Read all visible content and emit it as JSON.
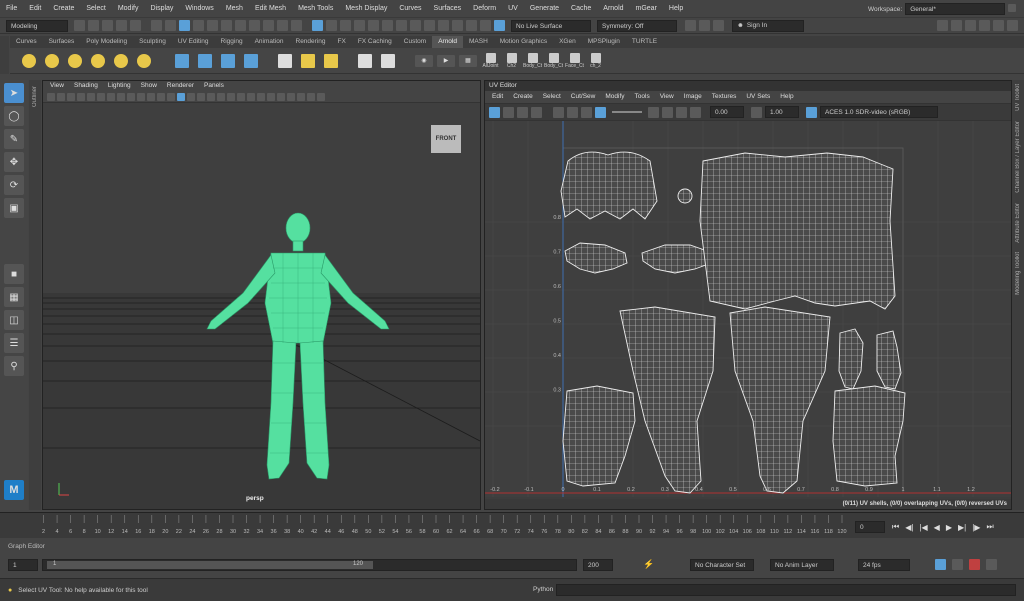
{
  "menubar": {
    "items": [
      "File",
      "Edit",
      "Create",
      "Select",
      "Modify",
      "Display",
      "Windows",
      "Mesh",
      "Edit Mesh",
      "Mesh Tools",
      "Mesh Display",
      "Curves",
      "Surfaces",
      "Deform",
      "UV",
      "Generate",
      "Cache",
      "Arnold",
      "mGear",
      "Help"
    ],
    "workspace_label": "Workspace:",
    "workspace_value": "General*"
  },
  "statusline": {
    "mode": "Modeling",
    "live_surface": "No Live Surface",
    "symmetry": "Symmetry: Off",
    "sign_in": "Sign In"
  },
  "shelf": {
    "tabs": [
      "Curves",
      "Surfaces",
      "Poly Modeling",
      "Sculpting",
      "UV Editing",
      "Rigging",
      "Animation",
      "Rendering",
      "FX",
      "FX Caching",
      "Custom",
      "Arnold",
      "MASH",
      "Motion Graphics",
      "XGen",
      "MPSPlugin",
      "TURTLE"
    ],
    "active_tab": "Arnold",
    "buttons": [
      "AllJoint",
      "Ch2",
      "Body_Ct",
      "Body_Ct",
      "Face_Ct",
      "ch_2"
    ]
  },
  "left_strip_label": "Outliner",
  "viewport": {
    "menu": [
      "View",
      "Shading",
      "Lighting",
      "Show",
      "Renderer",
      "Panels"
    ],
    "view_cube": "FRONT",
    "camera": "persp"
  },
  "uv_editor": {
    "title": "UV Editor",
    "menu": [
      "Edit",
      "Create",
      "Select",
      "Cut/Sew",
      "Modify",
      "Tools",
      "View",
      "Image",
      "Textures",
      "UV Sets",
      "Help"
    ],
    "exposure": "0.00",
    "gamma": "1.00",
    "color_space": "ACES 1.0 SDR-video (sRGB)",
    "status": "(0/11) UV shells, (0/0) overlapping UVs, (0/0) reversed UVs",
    "x_ticks": [
      "-0.2",
      "-0.1",
      "0",
      "0.1",
      "0.2",
      "0.3",
      "0.4",
      "0.5",
      "0.6",
      "0.7",
      "0.8",
      "0.9",
      "1",
      "1.1",
      "1.2"
    ],
    "y_ticks": [
      "0.8",
      "0.7",
      "0.6",
      "0.5",
      "0.4",
      "0.3"
    ]
  },
  "right_strip_labels": [
    "UV Toolkit",
    "Channel Box / Layer Editor",
    "Attribute Editor",
    "Modeling Toolkit"
  ],
  "timeline": {
    "ticks": [
      "2",
      "4",
      "6",
      "8",
      "10",
      "12",
      "14",
      "16",
      "18",
      "20",
      "22",
      "24",
      "26",
      "28",
      "30",
      "32",
      "34",
      "36",
      "38",
      "40",
      "42",
      "44",
      "46",
      "48",
      "50",
      "52",
      "54",
      "56",
      "58",
      "60",
      "62",
      "64",
      "66",
      "68",
      "70",
      "72",
      "74",
      "76",
      "78",
      "80",
      "82",
      "84",
      "86",
      "88",
      "90",
      "92",
      "94",
      "96",
      "98",
      "100",
      "102",
      "104",
      "106",
      "108",
      "110",
      "112",
      "114",
      "116",
      "118",
      "120"
    ],
    "current_frame": "0"
  },
  "graph_editor_label": "Graph Editor",
  "range": {
    "start": "1",
    "range_start": "1",
    "range_end": "120",
    "end": "200",
    "character": "No Character Set",
    "anim_layer": "No Anim Layer",
    "fps": "24 fps"
  },
  "help_line": {
    "message": "Select UV Tool: No help available for this tool",
    "python_label": "Python"
  },
  "colors": {
    "mesh": "#55e0a0",
    "accent": "#4a8fd0",
    "uv_grid_line": "#e0e0e0"
  }
}
